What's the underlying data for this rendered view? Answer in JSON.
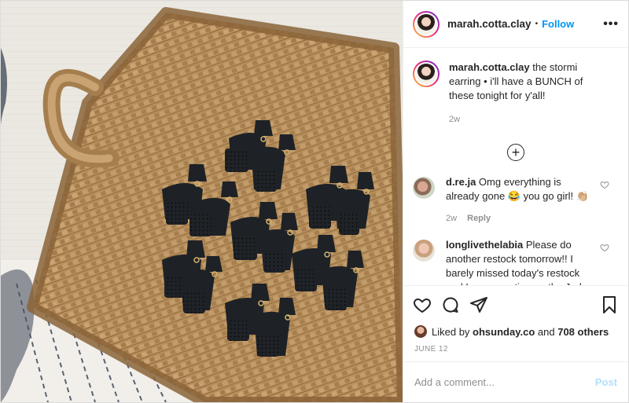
{
  "header": {
    "username": "marah.cotta.clay",
    "separator": "•",
    "follow_label": "Follow",
    "more_label": "•••"
  },
  "caption": {
    "username": "marah.cotta.clay",
    "text": "the stormi earring • i'll have a BUNCH of these tonight for y'all!",
    "time": "2w"
  },
  "load_more": {
    "icon": "plus-circle-icon",
    "label": "+"
  },
  "comments": [
    {
      "username": "d.re.ja",
      "text": "Omg everything is already gone 😂 you go girl! 👏🏼",
      "time": "2w",
      "reply_label": "Reply"
    },
    {
      "username": "longlivethelabia",
      "text": "Please do another restock tomorrow!! I barely missed today's restock and I was counting on the Jada earrings and the Goddess earrings 💔"
    }
  ],
  "actions": {
    "like_icon": "heart-icon",
    "comment_icon": "comment-icon",
    "share_icon": "paper-plane-icon",
    "save_icon": "bookmark-icon"
  },
  "likes": {
    "prefix": "Liked by",
    "user": "ohsunday.co",
    "middle": "and",
    "others": "708 others"
  },
  "date": "JUNE 12",
  "add_comment": {
    "placeholder": "Add a comment...",
    "post_label": "Post"
  },
  "colors": {
    "accent": "#0095f6",
    "post_disabled": "#b2dffc",
    "muted": "#8e8e8e"
  }
}
